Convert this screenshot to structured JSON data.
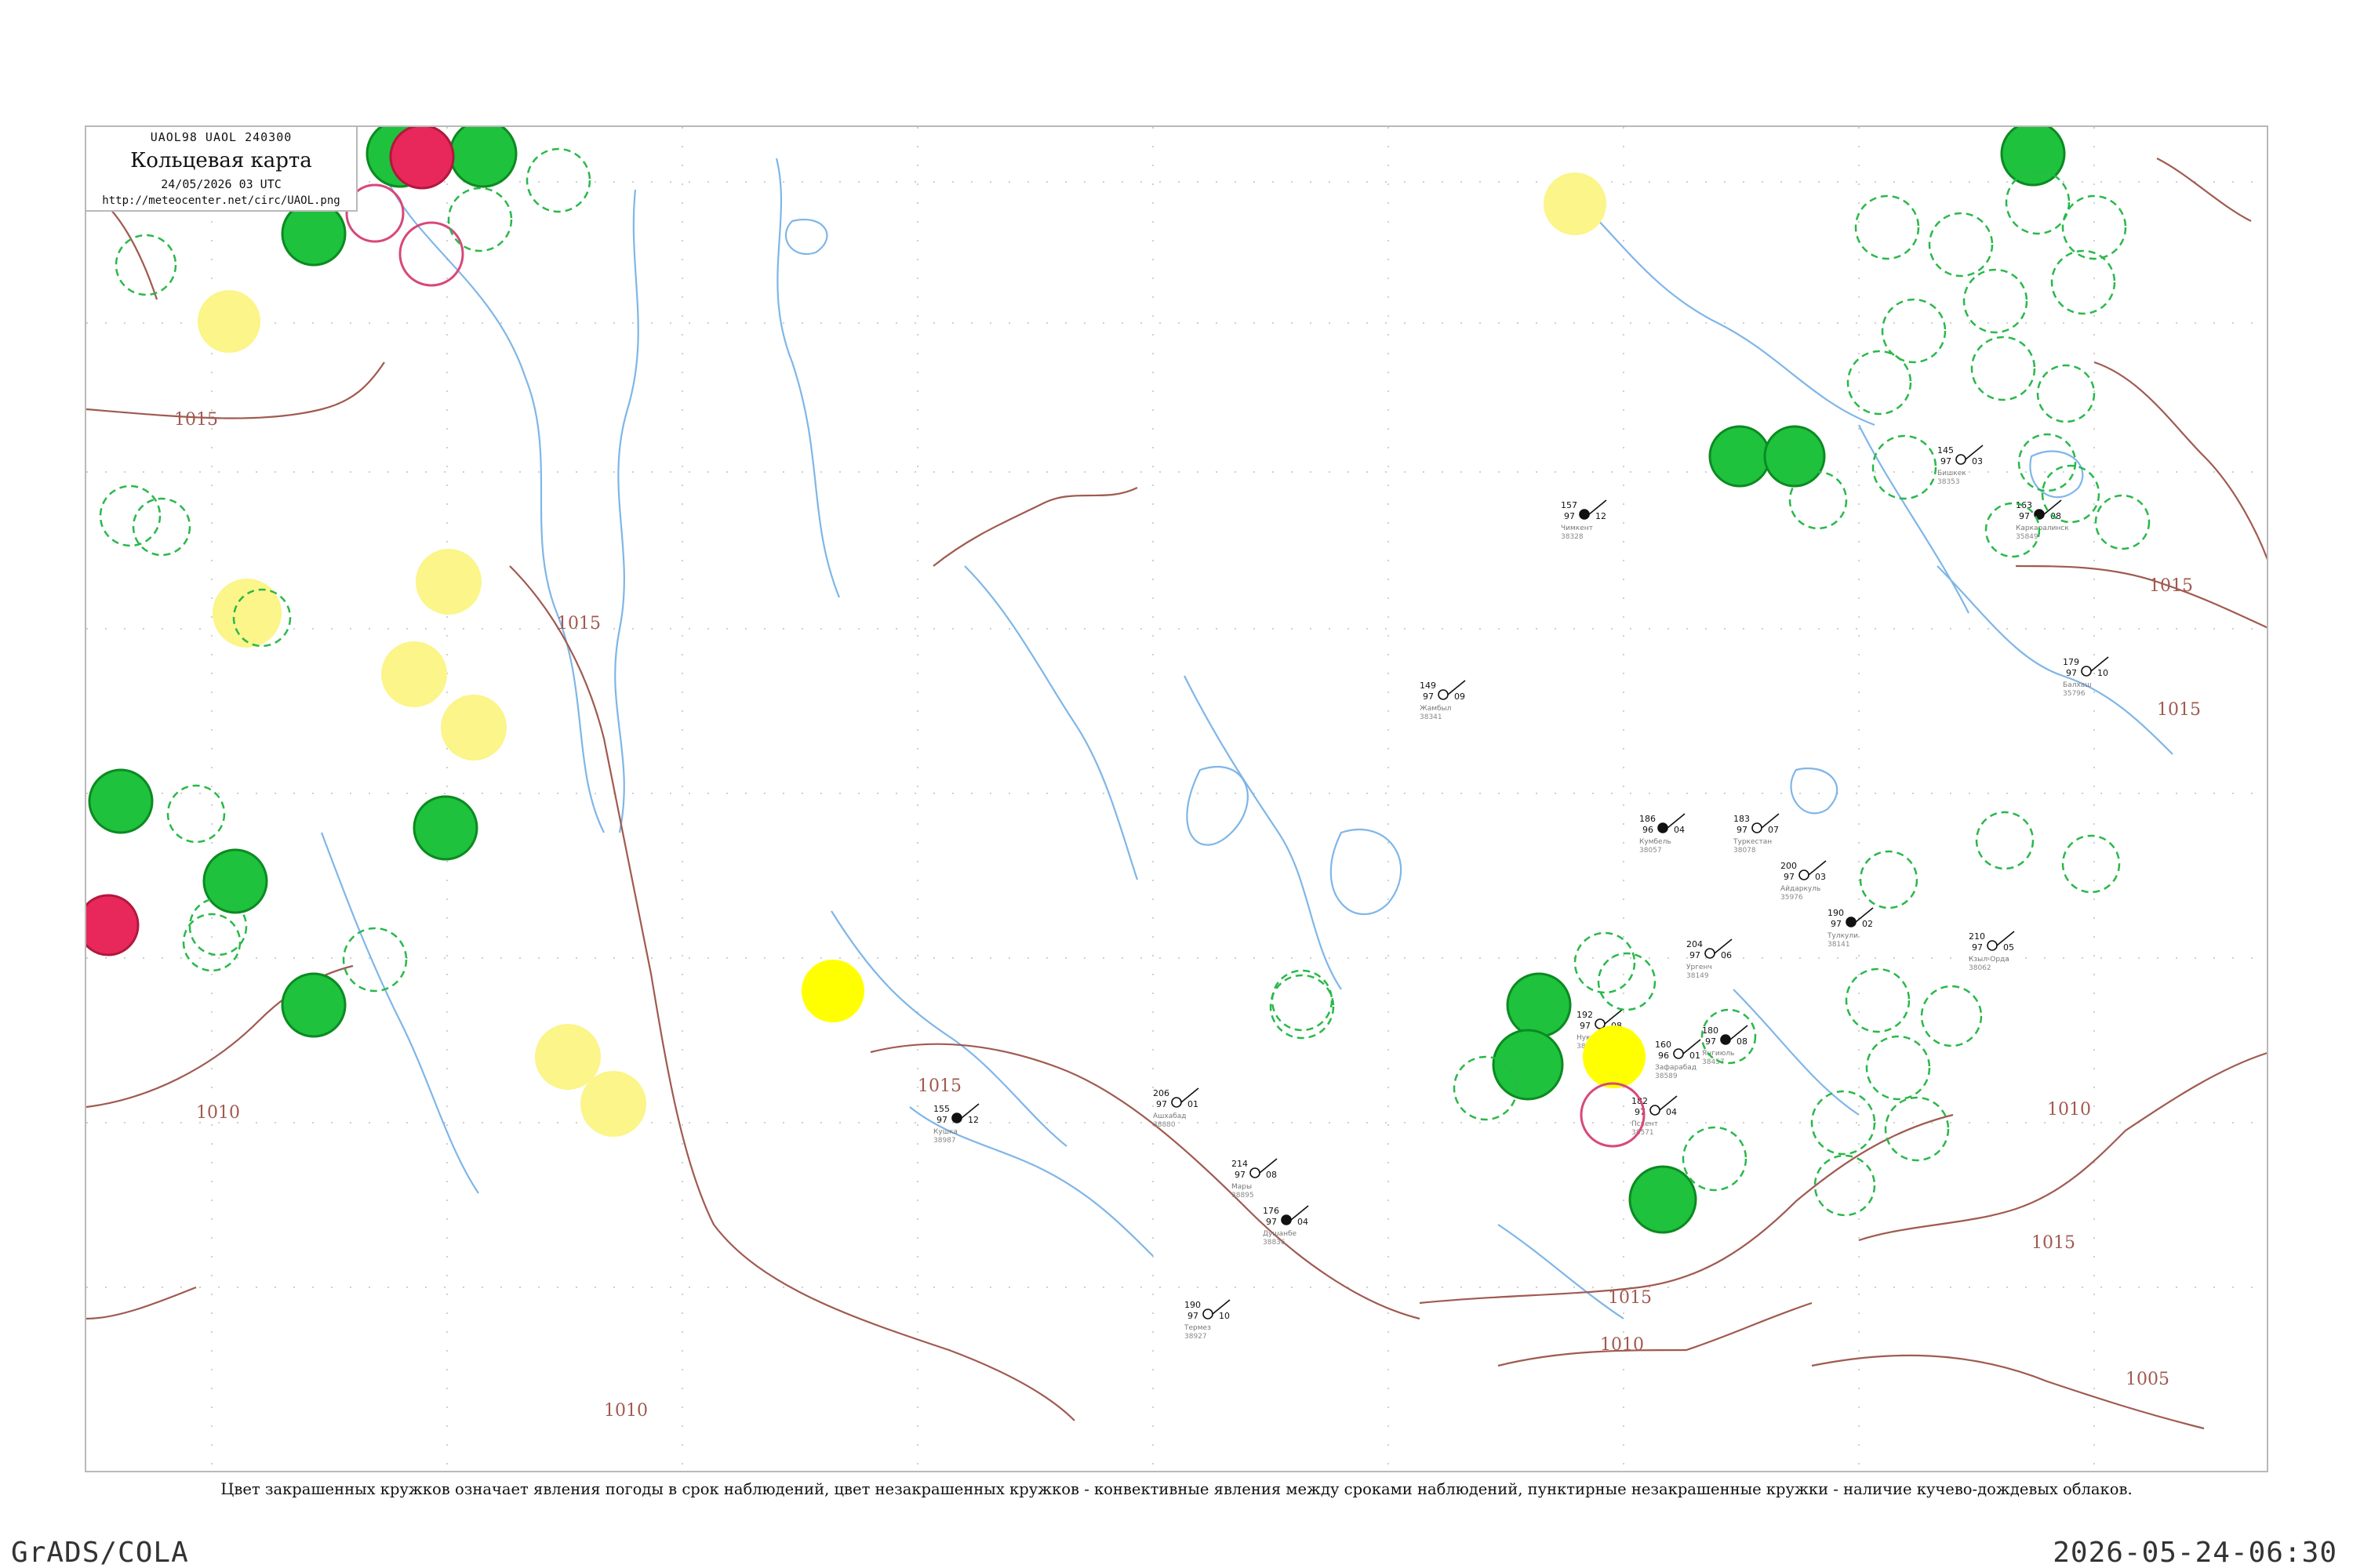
{
  "title_block": {
    "header": "UAOL98  UAOL  240300",
    "title": "Кольцевая карта",
    "date": "24/05/2026 03 UTC",
    "url": "http://meteocenter.net/circ/UAOL.png"
  },
  "footnote": "Цвет закрашенных кружков означает явления погоды в срок наблюдений, цвет незакрашенных кружков - конвективные явления между сроками наблюдений, пунктирные незакрашенные кружки - наличие кучево-дождевых облаков.",
  "footer": {
    "software": "GrADS/COLA",
    "timestamp": "2026-05-24-06:30"
  },
  "isobars": [
    {
      "label": "1015"
    },
    {
      "label": "1015"
    },
    {
      "label": "1010"
    },
    {
      "label": "1015"
    },
    {
      "label": "1010"
    },
    {
      "label": "1015"
    },
    {
      "label": "1010"
    },
    {
      "label": "1015"
    },
    {
      "label": "1010"
    },
    {
      "label": "1005"
    },
    {
      "label": "1015"
    },
    {
      "label": "1015"
    }
  ],
  "colors": {
    "green_fill": "#1ec23c",
    "yellow_fill": "#fbf58a",
    "bright_yellow_fill": "#ffff00",
    "red_fill": "#e8285a",
    "dashed_green": "#29b84a",
    "isobar": "#a05a50",
    "river": "#7fb6e8",
    "frame": "#b9b9b9"
  },
  "stations": [
    {
      "name": "Янгиюль",
      "id": "38457",
      "t": "180",
      "td": "97",
      "p": "08"
    },
    {
      "name": "Зафарабад",
      "id": "38589",
      "t": "160",
      "td": "96",
      "p": "01"
    },
    {
      "name": "Пскент",
      "id": "38571",
      "t": "182",
      "td": "97",
      "p": "04"
    },
    {
      "name": "Тулкули",
      "id": "38141",
      "t": "190",
      "td": "97",
      "p": "02"
    },
    {
      "name": "Айдаркуль",
      "id": "35976",
      "t": "200",
      "td": "97",
      "p": "03"
    },
    {
      "name": "Ургенч",
      "id": "38149",
      "t": "204",
      "td": "97",
      "p": "06"
    },
    {
      "name": "Кумбель",
      "id": "38057",
      "t": "186",
      "td": "96",
      "p": "04"
    },
    {
      "name": "Туркестан",
      "id": "38078",
      "t": "183",
      "td": "97",
      "p": "07"
    },
    {
      "name": "Нукус",
      "id": "38264",
      "t": "192",
      "td": "97",
      "p": "08"
    },
    {
      "name": "Чимкент",
      "id": "38328",
      "t": "157",
      "td": "97",
      "p": "12"
    },
    {
      "name": "Жамбыл",
      "id": "38341",
      "t": "149",
      "td": "97",
      "p": "09"
    },
    {
      "name": "Балхаш",
      "id": "35796",
      "t": "179",
      "td": "97",
      "p": "10"
    },
    {
      "name": "Каркаралинск",
      "id": "35849",
      "t": "163",
      "td": "97",
      "p": "08"
    },
    {
      "name": "Бишкек",
      "id": "38353",
      "t": "145",
      "td": "97",
      "p": "03"
    },
    {
      "name": "Кзыл-Орда",
      "id": "38062",
      "t": "210",
      "td": "97",
      "p": "05"
    },
    {
      "name": "Душанбе",
      "id": "38836",
      "t": "176",
      "td": "97",
      "p": "04"
    },
    {
      "name": "Ашхабад",
      "id": "38880",
      "t": "206",
      "td": "97",
      "p": "01"
    },
    {
      "name": "Мары",
      "id": "38895",
      "t": "214",
      "td": "97",
      "p": "08"
    },
    {
      "name": "Кушка",
      "id": "38987",
      "t": "155",
      "td": "97",
      "p": "12"
    },
    {
      "name": "Термез",
      "id": "38927",
      "t": "190",
      "td": "97",
      "p": "10"
    }
  ]
}
